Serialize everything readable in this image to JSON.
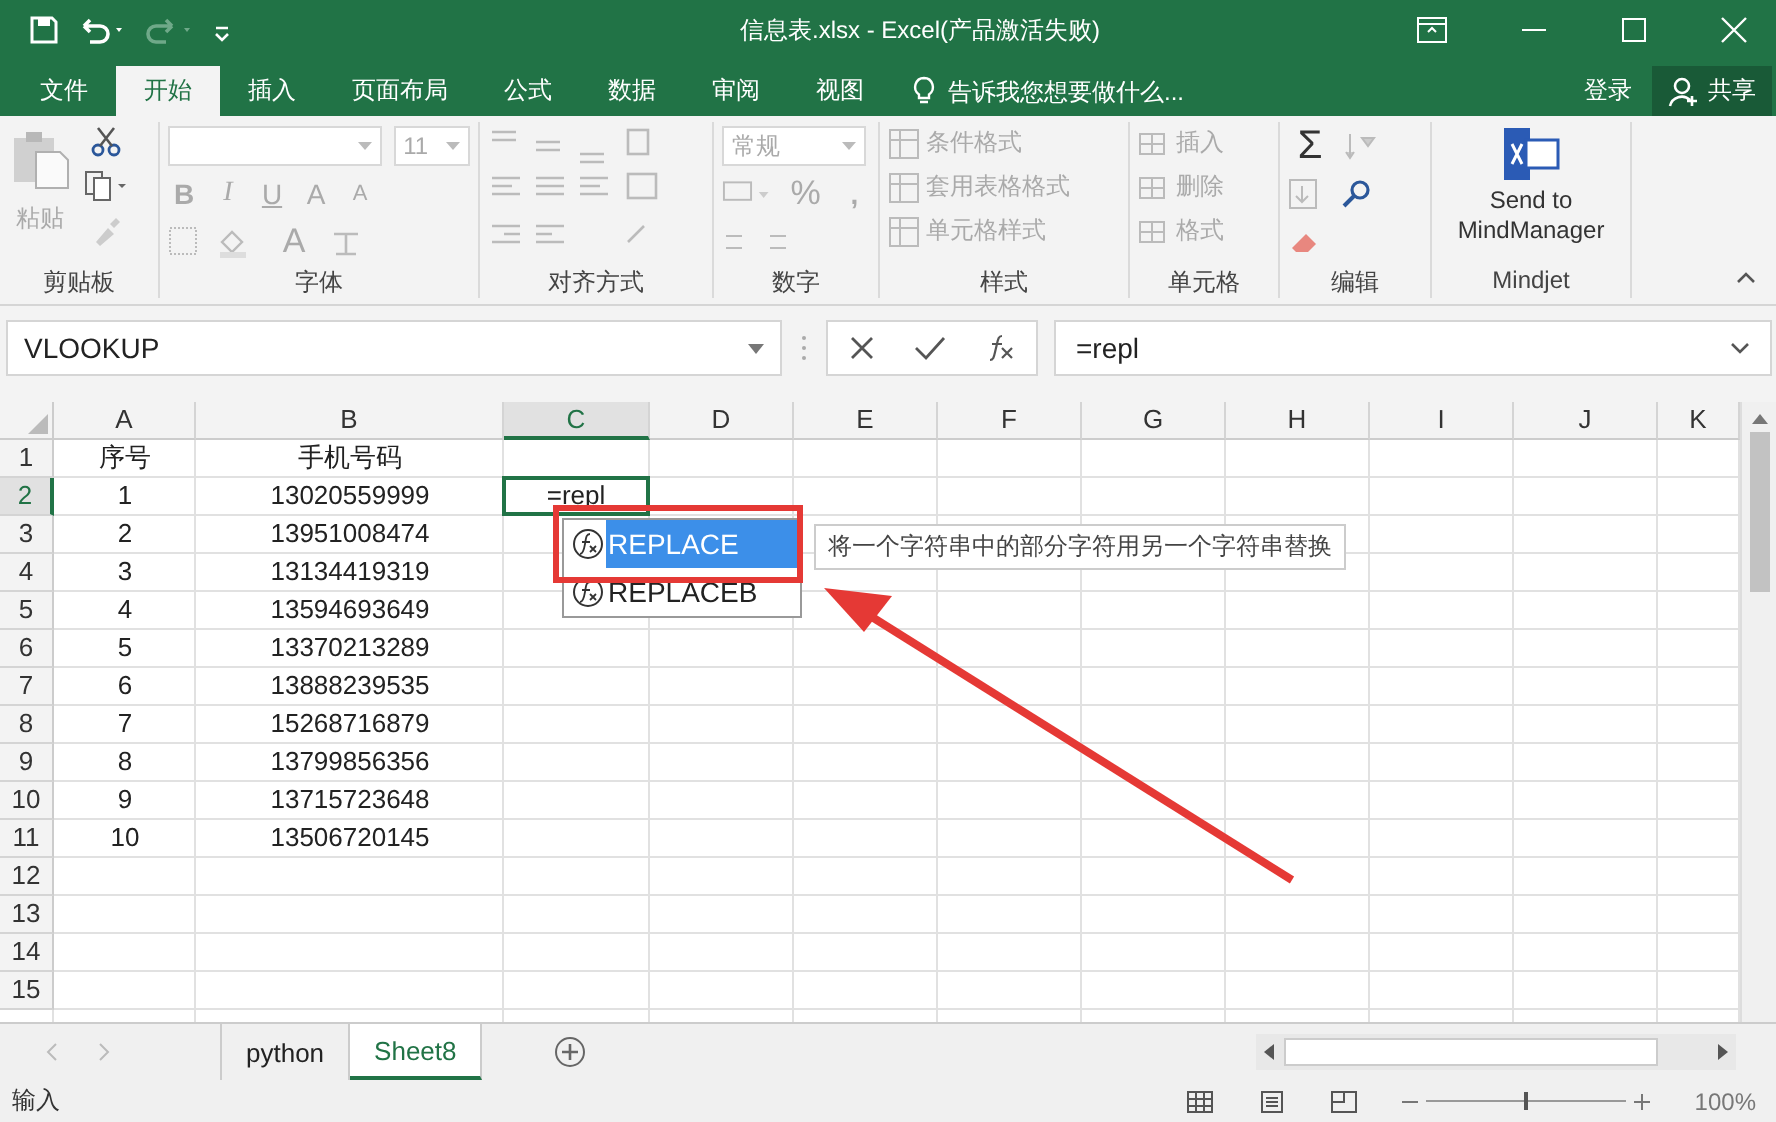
{
  "window": {
    "title": "信息表.xlsx - Excel(产品激活失败)"
  },
  "ribbon_tabs": [
    {
      "label": "文件",
      "selected": false
    },
    {
      "label": "开始",
      "selected": true
    },
    {
      "label": "插入",
      "selected": false
    },
    {
      "label": "页面布局",
      "selected": false
    },
    {
      "label": "公式",
      "selected": false
    },
    {
      "label": "数据",
      "selected": false
    },
    {
      "label": "审阅",
      "selected": false
    },
    {
      "label": "视图",
      "selected": false
    }
  ],
  "tell_me": {
    "placeholder": "告诉我您想要做什么..."
  },
  "account": {
    "sign_in": "登录",
    "share": "共享"
  },
  "ribbon": {
    "clipboard": {
      "label": "剪贴板",
      "paste": "粘贴"
    },
    "font": {
      "label": "字体",
      "size": "11",
      "bold": "B",
      "italic": "I",
      "underline": "U",
      "grow": "A",
      "shrink": "A",
      "font_color": "A"
    },
    "alignment": {
      "label": "对齐方式"
    },
    "number": {
      "label": "数字",
      "format": "常规",
      "percent": "%",
      "comma": ","
    },
    "styles": {
      "label": "样式",
      "items": [
        {
          "label": "条件格式",
          "disabled": true
        },
        {
          "label": "套用表格格式",
          "disabled": true
        },
        {
          "label": "单元格样式",
          "disabled": true
        }
      ]
    },
    "cells": {
      "label": "单元格",
      "items": [
        {
          "label": "插入",
          "disabled": true
        },
        {
          "label": "删除",
          "disabled": true
        },
        {
          "label": "格式",
          "disabled": true
        }
      ]
    },
    "editing": {
      "label": "编辑",
      "sum": "Σ"
    },
    "mindjet": {
      "label": "Mindjet",
      "button": "Send to MindManager"
    }
  },
  "formula_bar": {
    "name_box": "VLOOKUP",
    "formula": "=repl"
  },
  "sheet": {
    "columns": [
      {
        "label": "A",
        "selected": false
      },
      {
        "label": "B",
        "selected": false
      },
      {
        "label": "C",
        "selected": true
      },
      {
        "label": "D",
        "selected": false
      },
      {
        "label": "E",
        "selected": false
      },
      {
        "label": "F",
        "selected": false
      },
      {
        "label": "G",
        "selected": false
      },
      {
        "label": "H",
        "selected": false
      },
      {
        "label": "I",
        "selected": false
      },
      {
        "label": "J",
        "selected": false
      },
      {
        "label": "K",
        "selected": false
      }
    ],
    "rows": [
      {
        "label": "1",
        "selected": false,
        "cells": [
          "序号",
          "手机号码"
        ]
      },
      {
        "label": "2",
        "selected": true,
        "cells": [
          "1",
          "13020559999",
          "=repl"
        ]
      },
      {
        "label": "3",
        "selected": false,
        "cells": [
          "2",
          "13951008474"
        ]
      },
      {
        "label": "4",
        "selected": false,
        "cells": [
          "3",
          "13134419319"
        ]
      },
      {
        "label": "5",
        "selected": false,
        "cells": [
          "4",
          "13594693649"
        ]
      },
      {
        "label": "6",
        "selected": false,
        "cells": [
          "5",
          "13370213289"
        ]
      },
      {
        "label": "7",
        "selected": false,
        "cells": [
          "6",
          "13888239535"
        ]
      },
      {
        "label": "8",
        "selected": false,
        "cells": [
          "7",
          "15268716879"
        ]
      },
      {
        "label": "9",
        "selected": false,
        "cells": [
          "8",
          "13799856356"
        ]
      },
      {
        "label": "10",
        "selected": false,
        "cells": [
          "9",
          "13715723648"
        ]
      },
      {
        "label": "11",
        "selected": false,
        "cells": [
          "10",
          "13506720145"
        ]
      },
      {
        "label": "12",
        "selected": false,
        "cells": []
      },
      {
        "label": "13",
        "selected": false,
        "cells": []
      },
      {
        "label": "14",
        "selected": false,
        "cells": []
      },
      {
        "label": "15",
        "selected": false,
        "cells": []
      }
    ]
  },
  "autocomplete": {
    "items": [
      {
        "label": "REPLACE",
        "selected": true
      },
      {
        "label": "REPLACEB",
        "selected": false
      }
    ],
    "tooltip": "将一个字符串中的部分字符用另一个字符串替换"
  },
  "sheet_tabs": [
    {
      "label": "python",
      "selected": false
    },
    {
      "label": "Sheet8",
      "selected": true
    }
  ],
  "status_bar": {
    "mode": "输入",
    "zoom_slider": {
      "level": 0.5
    },
    "zoom": "100%"
  }
}
